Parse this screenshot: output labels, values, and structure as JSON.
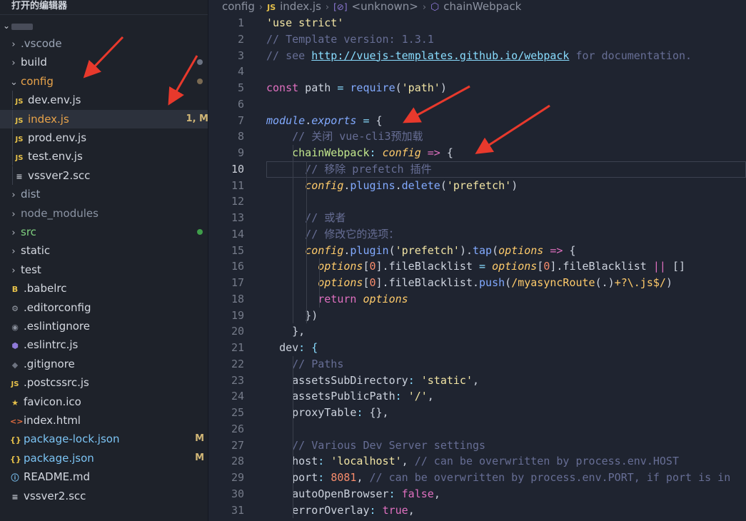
{
  "sidebar": {
    "header": "打开的编辑器",
    "items": [
      {
        "label": ".vscode",
        "type": "folder",
        "color": "#9aa4b5",
        "dot": null
      },
      {
        "label": "build",
        "type": "folder",
        "color": "#d4d8e0",
        "dot": "#6b7382"
      },
      {
        "label": "config",
        "type": "folder-open",
        "color": "#e8a34a",
        "dot": "#7a6a52"
      },
      {
        "label": "dev.env.js",
        "type": "js",
        "color": "#d4d8e0"
      },
      {
        "label": "index.js",
        "type": "js",
        "color": "#e8a34a",
        "badge": "1, M",
        "selected": true
      },
      {
        "label": "prod.env.js",
        "type": "js",
        "color": "#d4d8e0"
      },
      {
        "label": "test.env.js",
        "type": "js",
        "color": "#d4d8e0"
      },
      {
        "label": "vssver2.scc",
        "type": "file",
        "color": "#d4d8e0"
      },
      {
        "label": "dist",
        "type": "folder",
        "color": "#9aa4b5"
      },
      {
        "label": "node_modules",
        "type": "folder",
        "color": "#8b94a4"
      },
      {
        "label": "src",
        "type": "folder",
        "color": "#7fd07f",
        "dot": "#3f9e4a"
      },
      {
        "label": "static",
        "type": "folder",
        "color": "#d4d8e0"
      },
      {
        "label": "test",
        "type": "folder",
        "color": "#d4d8e0"
      },
      {
        "label": ".babelrc",
        "type": "babel",
        "color": "#d4d8e0"
      },
      {
        "label": ".editorconfig",
        "type": "gear",
        "color": "#d4d8e0"
      },
      {
        "label": ".eslintignore",
        "type": "circle",
        "color": "#d4d8e0"
      },
      {
        "label": ".eslintrc.js",
        "type": "eslint",
        "color": "#d4d8e0"
      },
      {
        "label": ".gitignore",
        "type": "git",
        "color": "#d4d8e0"
      },
      {
        "label": ".postcssrc.js",
        "type": "js",
        "color": "#d4d8e0"
      },
      {
        "label": "favicon.ico",
        "type": "star",
        "color": "#d4d8e0"
      },
      {
        "label": "index.html",
        "type": "html",
        "color": "#d4d8e0"
      },
      {
        "label": "package-lock.json",
        "type": "json",
        "color": "#7cc4f4",
        "badge": "M"
      },
      {
        "label": "package.json",
        "type": "json",
        "color": "#7cc4f4",
        "badge": "M"
      },
      {
        "label": "README.md",
        "type": "info",
        "color": "#d4d8e0"
      },
      {
        "label": "vssver2.scc",
        "type": "file",
        "color": "#d4d8e0"
      }
    ]
  },
  "breadcrumb": {
    "folder": "config",
    "file": "index.js",
    "symbol1": "<unknown>",
    "symbol2": "chainWebpack"
  },
  "code": {
    "lines": [
      {
        "n": "1",
        "tokens": [
          [
            "'use strict'",
            "t-strw"
          ]
        ]
      },
      {
        "n": "2",
        "tokens": [
          [
            "// Template version: 1.3.1",
            "t-com"
          ]
        ]
      },
      {
        "n": "3",
        "tokens": [
          [
            "// see ",
            "t-com"
          ],
          [
            "http://vuejs-templates.github.io/webpack",
            "t-link"
          ],
          [
            " for documentation.",
            "t-com"
          ]
        ]
      },
      {
        "n": "4",
        "tokens": []
      },
      {
        "n": "5",
        "tokens": [
          [
            "const",
            "t-kw"
          ],
          [
            " path ",
            "t-pl"
          ],
          [
            "=",
            "t-op"
          ],
          [
            " ",
            "t-pl"
          ],
          [
            "require",
            "t-fn"
          ],
          [
            "(",
            "t-pl"
          ],
          [
            "'path'",
            "t-strw"
          ],
          [
            ")",
            "t-pl"
          ]
        ]
      },
      {
        "n": "6",
        "tokens": []
      },
      {
        "n": "7",
        "tokens": [
          [
            "module",
            "t-fn t-it"
          ],
          [
            ".",
            "t-pl"
          ],
          [
            "exports",
            "t-fn t-it"
          ],
          [
            " ",
            "t-pl"
          ],
          [
            "=",
            "t-op"
          ],
          [
            " {",
            "t-pl"
          ]
        ]
      },
      {
        "n": "8",
        "tokens": [
          [
            "    // 关闭 vue-cli3预加载",
            "t-com"
          ]
        ]
      },
      {
        "n": "9",
        "tokens": [
          [
            "    ",
            "t-pl"
          ],
          [
            "chainWebpack",
            "t-green"
          ],
          [
            ": ",
            "t-cy"
          ],
          [
            "config",
            "t-var"
          ],
          [
            " ",
            "t-pl"
          ],
          [
            "=>",
            "t-kw"
          ],
          [
            " {",
            "t-pl"
          ]
        ]
      },
      {
        "n": "10",
        "tokens": [
          [
            "      // 移除 prefetch 插件",
            "t-com"
          ]
        ],
        "active": true
      },
      {
        "n": "11",
        "tokens": [
          [
            "      ",
            "t-pl"
          ],
          [
            "config",
            "t-var"
          ],
          [
            ".",
            "t-pl"
          ],
          [
            "plugins",
            "t-fn"
          ],
          [
            ".",
            "t-pl"
          ],
          [
            "delete",
            "t-fn"
          ],
          [
            "(",
            "t-pl"
          ],
          [
            "'prefetch'",
            "t-strw"
          ],
          [
            ")",
            "t-pl"
          ]
        ]
      },
      {
        "n": "12",
        "tokens": []
      },
      {
        "n": "13",
        "tokens": [
          [
            "      // 或者",
            "t-com"
          ]
        ]
      },
      {
        "n": "14",
        "tokens": [
          [
            "      // 修改它的选项：",
            "t-com"
          ]
        ]
      },
      {
        "n": "15",
        "tokens": [
          [
            "      ",
            "t-pl"
          ],
          [
            "config",
            "t-var"
          ],
          [
            ".",
            "t-pl"
          ],
          [
            "plugin",
            "t-fn"
          ],
          [
            "(",
            "t-pl"
          ],
          [
            "'prefetch'",
            "t-strw"
          ],
          [
            ").",
            "t-pl"
          ],
          [
            "tap",
            "t-fn"
          ],
          [
            "(",
            "t-pl"
          ],
          [
            "options",
            "t-var"
          ],
          [
            " ",
            "t-pl"
          ],
          [
            "=>",
            "t-kw"
          ],
          [
            " {",
            "t-pl"
          ]
        ]
      },
      {
        "n": "16",
        "tokens": [
          [
            "        ",
            "t-pl"
          ],
          [
            "options",
            "t-var"
          ],
          [
            "[",
            "t-pl"
          ],
          [
            "0",
            "t-num"
          ],
          [
            "].fileBlacklist ",
            "t-pl"
          ],
          [
            "=",
            "t-op"
          ],
          [
            " ",
            "t-pl"
          ],
          [
            "options",
            "t-var"
          ],
          [
            "[",
            "t-pl"
          ],
          [
            "0",
            "t-num"
          ],
          [
            "].fileBlacklist ",
            "t-pl"
          ],
          [
            "||",
            "t-kw"
          ],
          [
            " []",
            "t-pl"
          ]
        ]
      },
      {
        "n": "17",
        "tokens": [
          [
            "        ",
            "t-pl"
          ],
          [
            "options",
            "t-var"
          ],
          [
            "[",
            "t-pl"
          ],
          [
            "0",
            "t-num"
          ],
          [
            "].fileBlacklist.",
            "t-pl"
          ],
          [
            "push",
            "t-fn"
          ],
          [
            "(",
            "t-pl"
          ],
          [
            "/myasyncRoute",
            "t-yl"
          ],
          [
            "(.)",
            "t-pl"
          ],
          [
            "+?\\.js$",
            "t-yl"
          ],
          [
            "/",
            "t-yl"
          ],
          [
            ")",
            "t-pl"
          ]
        ]
      },
      {
        "n": "18",
        "tokens": [
          [
            "        ",
            "t-pl"
          ],
          [
            "return",
            "t-kw"
          ],
          [
            " ",
            "t-pl"
          ],
          [
            "options",
            "t-var"
          ]
        ]
      },
      {
        "n": "19",
        "tokens": [
          [
            "      })",
            "t-pl"
          ]
        ]
      },
      {
        "n": "20",
        "tokens": [
          [
            "    },",
            "t-pl"
          ]
        ]
      },
      {
        "n": "21",
        "tokens": [
          [
            "  ",
            "t-pl"
          ],
          [
            "dev",
            "t-pl"
          ],
          [
            ": {",
            "t-cy"
          ]
        ]
      },
      {
        "n": "22",
        "tokens": [
          [
            "    // Paths",
            "t-com"
          ]
        ]
      },
      {
        "n": "23",
        "tokens": [
          [
            "    assetsSubDirectory",
            "t-pl"
          ],
          [
            ": ",
            "t-cy"
          ],
          [
            "'static'",
            "t-strw"
          ],
          [
            ",",
            "t-pl"
          ]
        ]
      },
      {
        "n": "24",
        "tokens": [
          [
            "    assetsPublicPath",
            "t-pl"
          ],
          [
            ": ",
            "t-cy"
          ],
          [
            "'/'",
            "t-strw"
          ],
          [
            ",",
            "t-pl"
          ]
        ]
      },
      {
        "n": "25",
        "tokens": [
          [
            "    proxyTable",
            "t-pl"
          ],
          [
            ": ",
            "t-cy"
          ],
          [
            "{},",
            "t-pl"
          ]
        ]
      },
      {
        "n": "26",
        "tokens": []
      },
      {
        "n": "27",
        "tokens": [
          [
            "    // Various Dev Server settings",
            "t-com"
          ]
        ]
      },
      {
        "n": "28",
        "tokens": [
          [
            "    host",
            "t-pl"
          ],
          [
            ": ",
            "t-cy"
          ],
          [
            "'localhost'",
            "t-strw"
          ],
          [
            ", ",
            "t-pl"
          ],
          [
            "// can be overwritten by process.env.HOST",
            "t-com"
          ]
        ]
      },
      {
        "n": "29",
        "tokens": [
          [
            "    port",
            "t-pl"
          ],
          [
            ": ",
            "t-cy"
          ],
          [
            "8081",
            "t-num"
          ],
          [
            ", ",
            "t-pl"
          ],
          [
            "// can be overwritten by process.env.PORT, if port is in",
            "t-com"
          ]
        ]
      },
      {
        "n": "30",
        "tokens": [
          [
            "    autoOpenBrowser",
            "t-pl"
          ],
          [
            ": ",
            "t-cy"
          ],
          [
            "false",
            "t-kw"
          ],
          [
            ",",
            "t-pl"
          ]
        ]
      },
      {
        "n": "31",
        "tokens": [
          [
            "    errorOverlay",
            "t-pl"
          ],
          [
            ": ",
            "t-cy"
          ],
          [
            "true",
            "t-kw"
          ],
          [
            ",",
            "t-pl"
          ]
        ]
      }
    ]
  },
  "colors": {
    "sidebar_bg": "#1e222a",
    "editor_bg": "#1f2430",
    "arrow": "#e8392c",
    "accent_orange": "#e8a34a"
  }
}
